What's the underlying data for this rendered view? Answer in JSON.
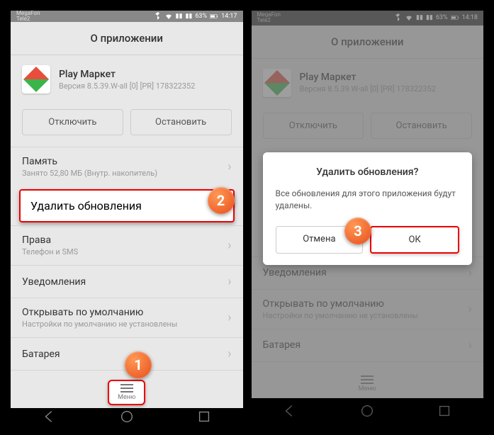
{
  "status": {
    "carrier1": "MegaFon",
    "carrier2": "Tele2",
    "battery": "63%",
    "time_left": "14:17",
    "time_right": "14:18"
  },
  "header": {
    "title": "О приложении"
  },
  "app": {
    "name": "Play Маркет",
    "version": "Версия 8.5.39.W-all [0] [PR] 178322352"
  },
  "buttons": {
    "disable": "Отключить",
    "stop": "Остановить"
  },
  "items": {
    "memory": {
      "title": "Память",
      "sub": "Занято 52,80 МБ (Внутр. накопитель)"
    },
    "uninstall_updates": "Удалить обновления",
    "permissions": {
      "title": "Права",
      "sub": "Телефон и SMS"
    },
    "notifications": "Уведомления",
    "open_default": {
      "title": "Открывать по умолчанию",
      "sub": "Настройки по умолчанию не установлены"
    },
    "battery": "Батарея"
  },
  "menu": {
    "label": "Меню"
  },
  "dialog": {
    "title": "Удалить обновления?",
    "message": "Все обновления для этого приложения будут удалены.",
    "cancel": "Отмена",
    "ok": "ОК"
  },
  "badges": {
    "b1": "1",
    "b2": "2",
    "b3": "3"
  }
}
